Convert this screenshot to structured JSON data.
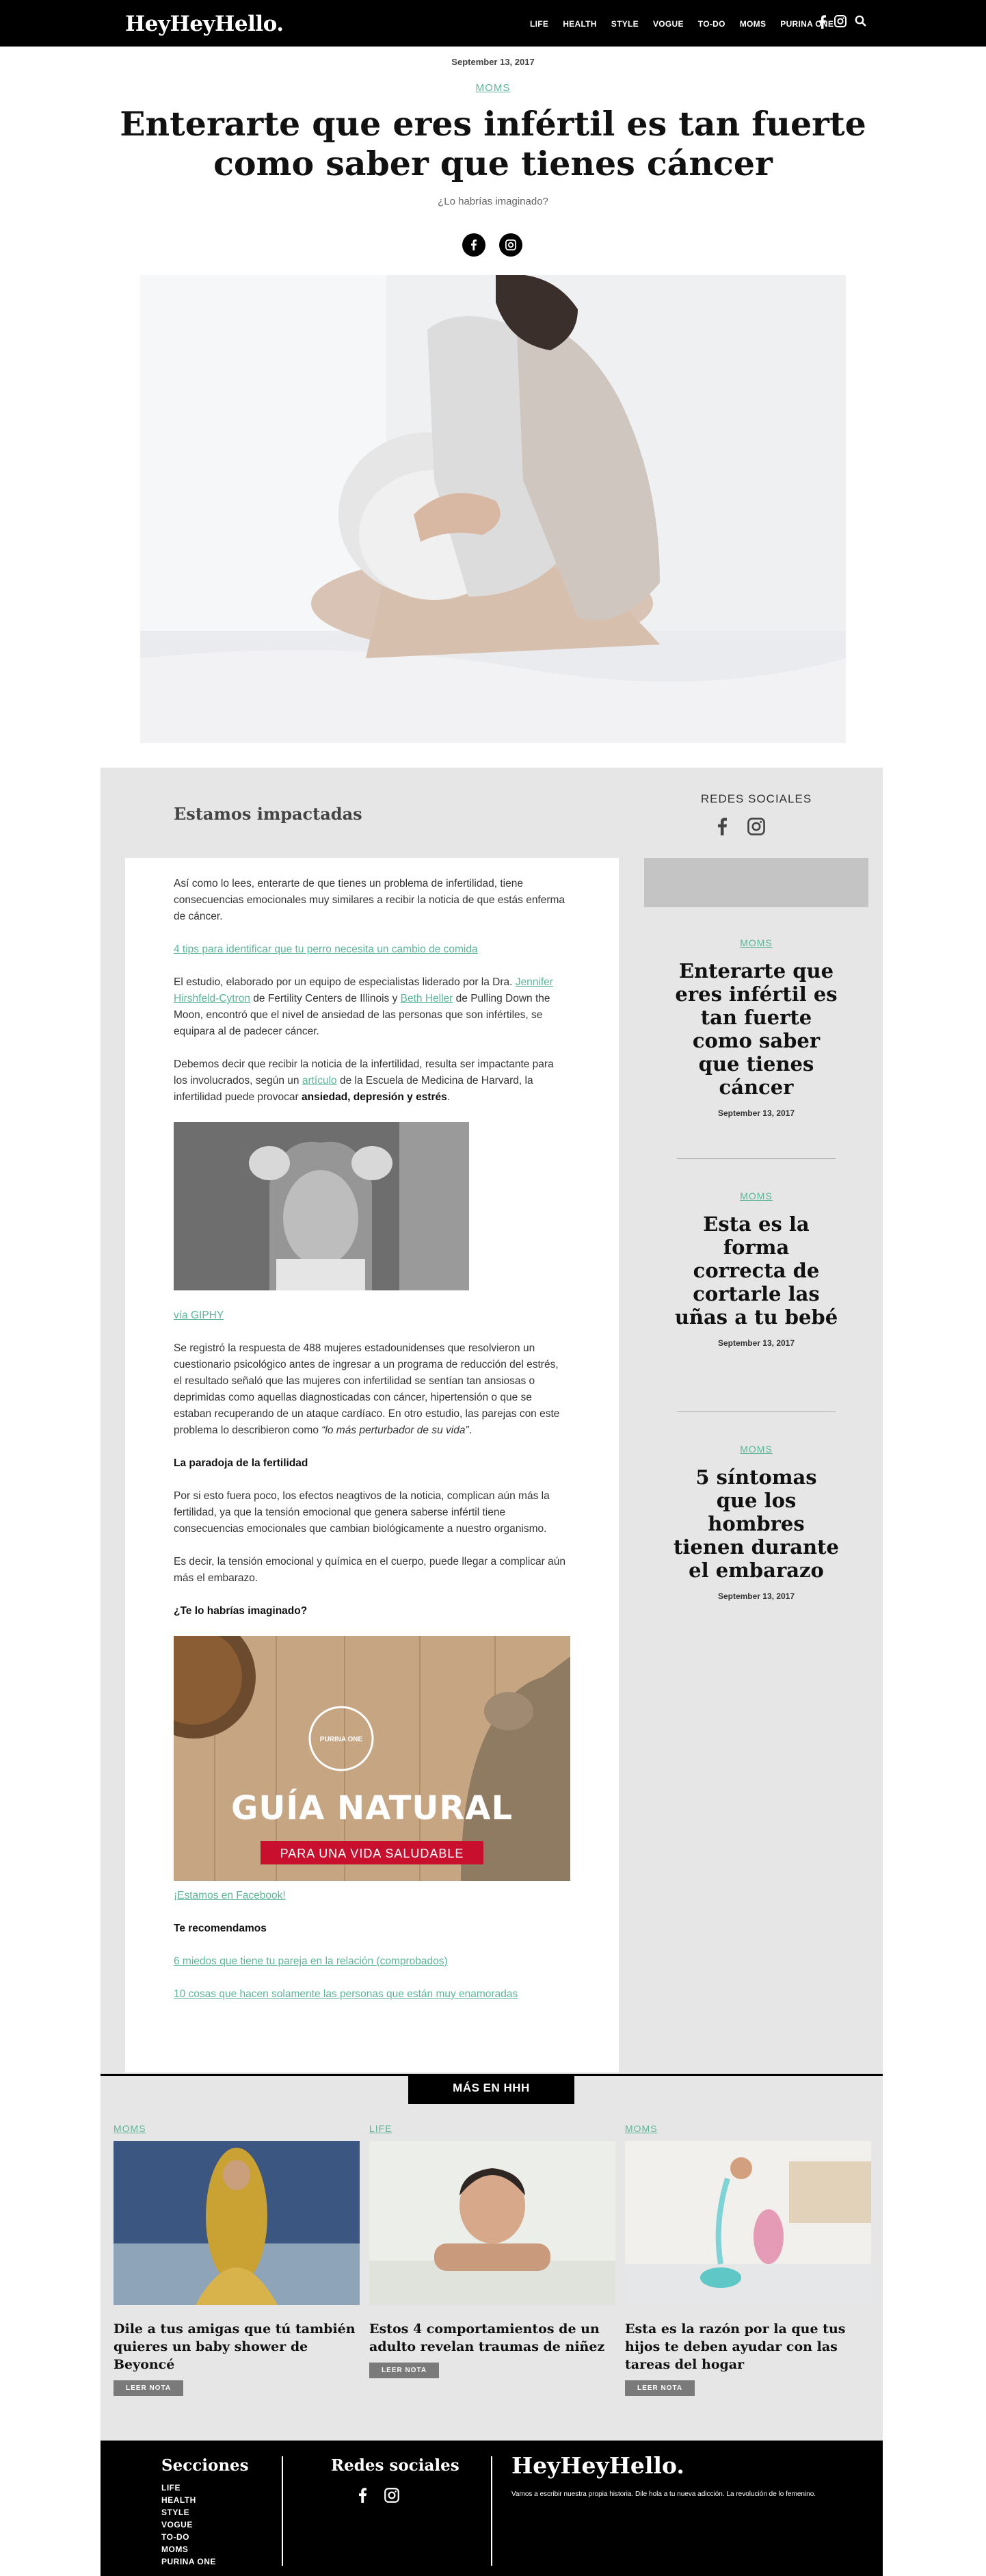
{
  "brand": "HeyHeyHello.",
  "nav": [
    "LIFE",
    "HEALTH",
    "STYLE",
    "VOGUE",
    "TO-DO",
    "MOMS",
    "PURINA ONE"
  ],
  "nav_icons": [
    "facebook-icon",
    "instagram-icon",
    "search-icon"
  ],
  "article": {
    "date": "September 13, 2017",
    "category": "MOMS",
    "title": "Enterarte que eres infértil es tan fuerte como saber que tienes cáncer",
    "subtitle": "¿Lo habrías imaginado?",
    "section_title": "Estamos impactadas",
    "p1": "Así como lo lees, enterarte de que tienes un problema de infertilidad, tiene consecuencias emocionales muy similares a recibir la noticia de que estás enferma de cáncer.",
    "link1": "4 tips para identificar que tu perro necesita un cambio de comida",
    "p2a": "El estudio, elaborado por un equipo de especialistas liderado por la Dra. ",
    "p2_link_a": "Jennifer Hirshfeld-Cytron",
    "p2b": " de Fertility Centers de Illinois y ",
    "p2_link_b": "Beth Heller",
    "p2c": " de Pulling Down the Moon, encontró que el nivel de ansiedad de las personas que son infértiles, se equipara al de padecer cáncer.",
    "p3a": "Debemos decir que recibir la noticia de la infertilidad, resulta ser impactante para los involucrados, según un ",
    "p3_link": "artículo",
    "p3b": " de la Escuela de Medicina de Harvard, la infertilidad puede provocar ",
    "p3_bold": "ansiedad, depresión y estrés",
    "p3c": ".",
    "giphy_link": "vía GIPHY",
    "p4a": "Se registró la respuesta de 488 mujeres estadounidenses que resolvieron un cuestionario psicológico antes de ingresar a un programa de reducción del estrés, el resultado señaló que las mujeres con infertilidad se sentían tan ansiosas o deprimidas como aquellas diagnosticadas con cáncer, hipertensión o que se estaban recuperando de un ataque cardíaco. En otro estudio, las parejas con este problema lo describieron como ",
    "p4_italic": "“lo más perturbador de su vida”",
    "p4b": ".",
    "h_paradoja": "La paradoja de la fertilidad",
    "p5": "Por si esto fuera poco, los efectos neagtivos de la noticia, complican aún más la fertilidad, ya que la tensión emocional que genera saberse infértil tiene consecuencias emocionales que cambian biológicamente a nuestro organismo.",
    "p6": "Es decir, la tensión emocional y química en el cuerpo, puede llegar a complicar aún más el embarazo.",
    "h_imaginado": "¿Te lo habrías imaginado?",
    "promo_brand": "PURINA ONE",
    "promo_title": "GUÍA NATURAL",
    "promo_sub": "PARA UNA VIDA SALUDABLE",
    "facebook_link": "¡Estamos en Facebook!",
    "h_recomendamos": "Te recomendamos",
    "rec1": "6 miedos que tiene tu pareja en la relación (comprobados)",
    "rec2": "10 cosas que hacen solamente las personas que están muy enamoradas"
  },
  "sidebar": {
    "redes_title": "REDES SOCIALES",
    "items": [
      {
        "category": "MOMS",
        "title": "Enterarte que eres infértil es tan fuerte como saber que tienes cáncer",
        "date": "September 13, 2017"
      },
      {
        "category": "MOMS",
        "title": "Esta es la forma correcta de cortarle las uñas a tu bebé",
        "date": "September 13, 2017"
      },
      {
        "category": "MOMS",
        "title": "5 síntomas que los hombres tienen durante el embarazo",
        "date": "September 13, 2017"
      }
    ]
  },
  "more": {
    "label": "MÁS EN HHH",
    "button": "LEER NOTA",
    "cards": [
      {
        "category": "MOMS",
        "title": "Dile a tus amigas que tú también quieres un baby shower de Beyoncé"
      },
      {
        "category": "LIFE",
        "title": "Estos 4 comportamientos de un adulto revelan traumas de niñez"
      },
      {
        "category": "MOMS",
        "title": "Esta es la razón por la que tus hijos te deben ayudar con las tareas del hogar"
      }
    ]
  },
  "footer": {
    "sections_title": "Secciones",
    "sections": [
      "LIFE",
      "HEALTH",
      "STYLE",
      "VOGUE",
      "TO-DO",
      "MOMS",
      "PURINA ONE"
    ],
    "social_title": "Redes sociales",
    "logo": "HeyHeyHello.",
    "tagline": "Vamos a escribir nuestra propia historia. Dile hola a tu nueva adicción. La revolución de lo femenino."
  },
  "colors": {
    "accent": "#5bb596",
    "gray_bg": "#e6e6e6",
    "black": "#000000"
  }
}
